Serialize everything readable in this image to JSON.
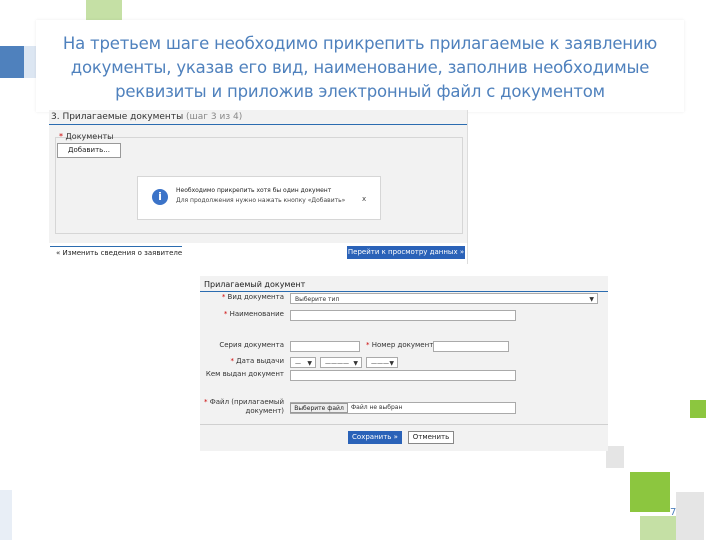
{
  "slide": {
    "title_lines": [
      "На третьем шаге необходимо прикрепить прилагаемые к заявлению",
      "документы, указав его вид, наименование, заполнив необходимые",
      "реквизиты и приложив электронный файл с документом"
    ],
    "page_number": "7",
    "colors": {
      "title": "#4f81bd",
      "accent_blue": "#2a62b8",
      "green": "#8cc63f",
      "green_light": "#c5e0a5",
      "gray_light": "#e5e5e5"
    }
  },
  "step_panel": {
    "header": "3. Прилагаемые документы",
    "header_step": "(шаг 3 из 4)",
    "documents_label": "Документы",
    "add_button": "Добавить...",
    "notice_icon": "info-icon",
    "notice_line1": "Необходимо прикрепить хотя бы один документ",
    "notice_line2": "Для продолжения нужно нажать кнопку «Добавить»",
    "notice_close": "x",
    "back_button": "« Изменить сведения о заявителе",
    "next_button": "Перейти к просмотру данных »"
  },
  "doc_form": {
    "header": "Прилагаемый документ",
    "doc_type_label": "Вид документа",
    "doc_type_value": "Выберите тип",
    "name_label": "Наименование",
    "series_label": "Серия документа",
    "number_label": "Номер документа",
    "date_label": "Дата выдачи",
    "date_day": "—",
    "date_month": "————",
    "date_year": "———",
    "issuer_label": "Кем выдан документ",
    "file_label_1": "Файл (прилагаемый",
    "file_label_2": "документ)",
    "file_button": "Выберите файл",
    "file_status": "Файл не выбран",
    "save_button": "Сохранить »",
    "cancel_button": "Отменить"
  }
}
